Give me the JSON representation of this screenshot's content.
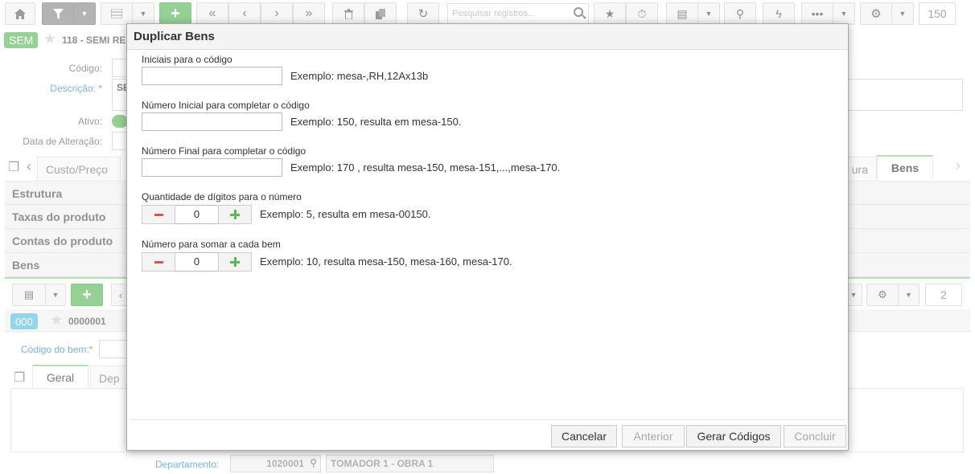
{
  "toolbar": {
    "search_placeholder": "Pesquisar registros...",
    "record_count": "150"
  },
  "record": {
    "badge": "SEM",
    "badge_color": "#5cb85c",
    "title": "118 - SEMI RE",
    "codigo_label": "Código:",
    "descricao_label": "Descrição:",
    "descricao_value": "SE",
    "ativo_label": "Ativo:",
    "data_alteracao_label": "Data de Alteração:"
  },
  "tabs": {
    "custo": "Custo/Preço",
    "partial": "ura",
    "bens": "Bens"
  },
  "panels": [
    "Estrutura",
    "Taxas do produto",
    "Contas do produto",
    "Bens"
  ],
  "subgrid": {
    "count": "2",
    "badge": "000",
    "badge_color": "#5bc0de",
    "item_code": "0000001",
    "codigo_bem_label": "Código do bem:",
    "tab_geral": "Geral",
    "tab_dep": "Dep",
    "departamento_label": "Departamento:",
    "departamento_code": "1020001",
    "departamento_name": "TOMADOR 1 - OBRA 1"
  },
  "dialog": {
    "title": "Duplicar Bens",
    "fields": {
      "iniciais_label": "Iniciais para o código",
      "iniciais_hint": "Exemplo: mesa-,RH,12Ax13b",
      "numero_inicial_label": "Número Inicial para completar o código",
      "numero_inicial_hint": "Exemplo: 150, resulta em mesa-150.",
      "numero_final_label": "Número Final para completar o código",
      "numero_final_hint": "Exemplo: 170 , resulta mesa-150, mesa-151,...,mesa-170.",
      "digitos_label": "Quantidade de dígitos para o número",
      "digitos_value": "0",
      "digitos_hint": "Exemplo: 5, resulta em mesa-00150.",
      "somar_label": "Número para somar a cada bem",
      "somar_value": "0",
      "somar_hint": "Exemplo: 10, resulta mesa-150, mesa-160, mesa-170."
    },
    "buttons": {
      "cancelar": "Cancelar",
      "anterior": "Anterior",
      "gerar": "Gerar Códigos",
      "concluir": "Concluir"
    }
  }
}
